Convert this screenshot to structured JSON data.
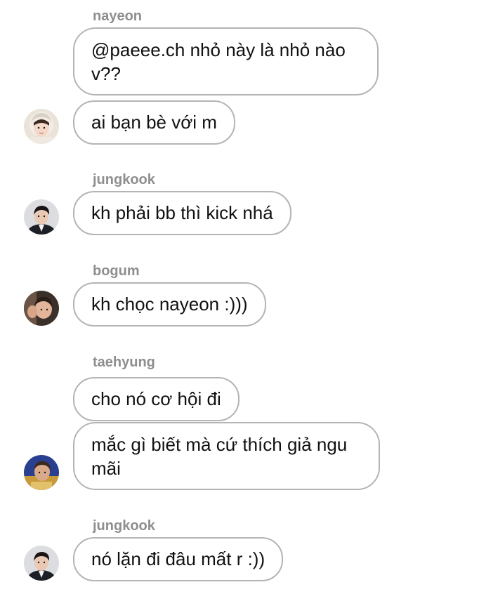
{
  "messages": [
    {
      "sender": "nayeon",
      "bubbles": [
        "@paeee.ch nhỏ này là nhỏ nào v??",
        "ai bạn bè với m"
      ],
      "avatar": "nayeon-avatar"
    },
    {
      "sender": "jungkook",
      "bubbles": [
        "kh phải bb thì kick nhá"
      ],
      "avatar": "jungkook-avatar"
    },
    {
      "sender": "bogum",
      "bubbles": [
        "kh chọc nayeon :)))"
      ],
      "avatar": "bogum-avatar"
    },
    {
      "sender": "taehyung",
      "bubbles": [
        "cho nó cơ hội đi",
        "mắc gì biết mà cứ thích giả ngu mãi"
      ],
      "avatar": "taehyung-avatar"
    },
    {
      "sender": "jungkook",
      "bubbles": [
        "nó lặn đi đâu mất r :))"
      ],
      "avatar": "jungkook-avatar"
    }
  ],
  "colors": {
    "sender_text": "#8e8e8e",
    "bubble_border": "#b4b4b4",
    "message_text": "#111111",
    "background": "#ffffff"
  }
}
